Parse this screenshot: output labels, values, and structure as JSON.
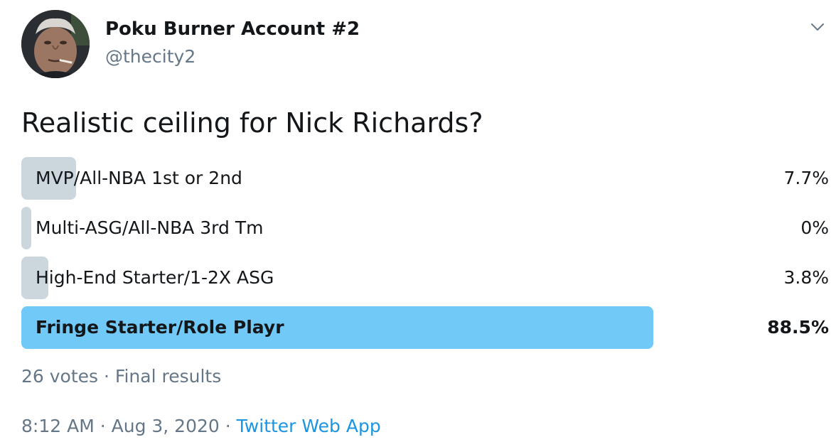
{
  "author": {
    "display_name": "Poku Burner Account #2",
    "handle": "@thecity2"
  },
  "icons": {
    "avatar": "profile-photo-icon",
    "menu": "chevron-down-icon"
  },
  "poll": {
    "question": "Realistic ceiling for Nick Richards?",
    "options": [
      {
        "label": "MVP/All-NBA 1st or 2nd",
        "percent_text": "7.7%",
        "percent": 7.7,
        "winner": false
      },
      {
        "label": "Multi-ASG/All-NBA 3rd Tm",
        "percent_text": "0%",
        "percent": 0,
        "winner": false
      },
      {
        "label": "High-End Starter/1-2X ASG",
        "percent_text": "3.8%",
        "percent": 3.8,
        "winner": false
      },
      {
        "label": "Fringe Starter/Role Playr",
        "percent_text": "88.5%",
        "percent": 88.5,
        "winner": true
      }
    ],
    "votes": "26 votes",
    "separator": "·",
    "status": "Final results"
  },
  "tweet_meta": {
    "time": "8:12 AM",
    "separator": "·",
    "date": "Aug 3, 2020",
    "separator2": "·",
    "source": "Twitter Web App"
  },
  "colors": {
    "bar_default": "#ccd6dd",
    "bar_winner": "#71c9f8",
    "link": "#1b95e0",
    "muted": "#657786"
  }
}
